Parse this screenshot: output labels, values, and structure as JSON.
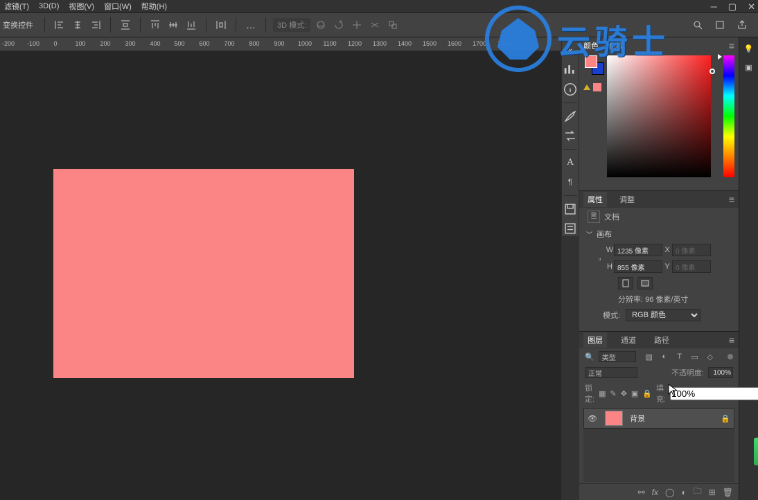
{
  "menu": {
    "filter": "滤镜(T)",
    "threeD": "3D(D)",
    "view": "视图(V)",
    "window": "窗口(W)",
    "help": "帮助(H)"
  },
  "options": {
    "transform_label": "变换控件",
    "mode3d_label": "3D 模式:"
  },
  "ruler": {
    "ticks": [
      -200,
      -100,
      0,
      100,
      200,
      300,
      400,
      500,
      600,
      700,
      800,
      900,
      1000,
      1100,
      1200,
      1300,
      1400,
      1500,
      1600,
      1700,
      1800
    ]
  },
  "panels": {
    "color": {
      "tab_color": "颜色",
      "tab_swatch": "色板"
    },
    "props": {
      "tab_props": "属性",
      "tab_adjust": "调整",
      "doc_label": "文档",
      "section_canvas": "画布",
      "w_label": "W",
      "w_value": "1235 像素",
      "h_label": "H",
      "h_value": "855 像素",
      "x_label": "X",
      "x_value": "0 像素",
      "y_label": "Y",
      "y_value": "0 像素",
      "resolution_label": "分辨率:",
      "resolution_value": "96 像素/英寸",
      "mode_label": "模式:",
      "mode_value": "RGB 颜色"
    },
    "layers": {
      "tab_layers": "图层",
      "tab_channels": "通道",
      "tab_paths": "路径",
      "filter_label": "类型",
      "blend_mode": "正常",
      "opacity_label": "不透明度:",
      "opacity_value": "100%",
      "lock_label": "锁定:",
      "fill_label": "填充:",
      "fill_value": "100%",
      "layer_name": "背景"
    }
  },
  "colors": {
    "canvas_fill": "#fb8585",
    "accent": "#2a7ddb"
  },
  "watermark": {
    "text": "云骑士"
  }
}
